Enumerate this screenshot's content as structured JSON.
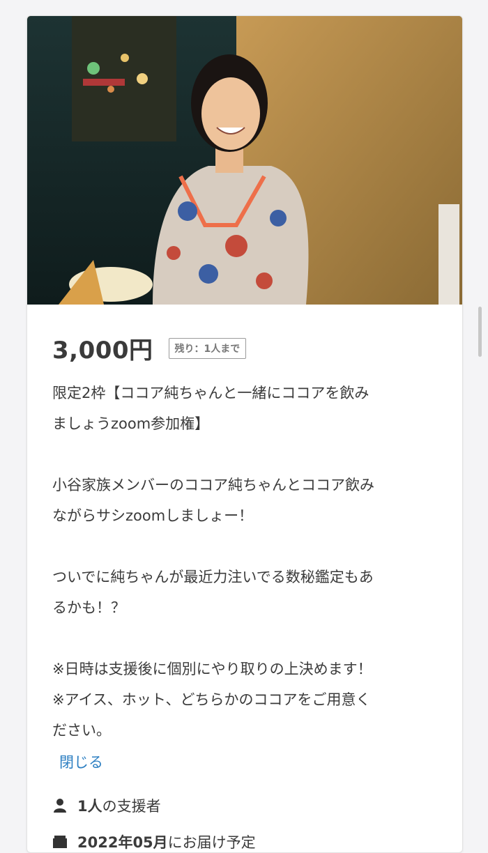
{
  "reward": {
    "price": "3,000円",
    "remaining_badge": "残り：1人まで",
    "description_lines": [
      "限定2枠【ココア純ちゃんと一緒にココアを飲み",
      "ましょうzoom参加権】",
      "",
      "小谷家族メンバーのココア純ちゃんとココア飲み",
      "ながらサシzoomしましょー！",
      "",
      "ついでに純ちゃんが最近力注いでる数秘鑑定もあ",
      "るかも！？",
      "",
      "※日時は支援後に個別にやり取りの上決めます！",
      "※アイス、ホット、どちらかのココアをご用意く",
      "ださい。"
    ],
    "close_link": "閉じる",
    "supporters_count": "1人",
    "supporters_suffix": "の支援者",
    "delivery_date": "2022年05月",
    "delivery_suffix": "にお届け予定"
  },
  "icons": {
    "supporters": "person-icon",
    "delivery": "package-icon"
  },
  "colors": {
    "link": "#2d7fc2",
    "price": "#3a3a3a",
    "badge_border": "#9a9a9a"
  }
}
